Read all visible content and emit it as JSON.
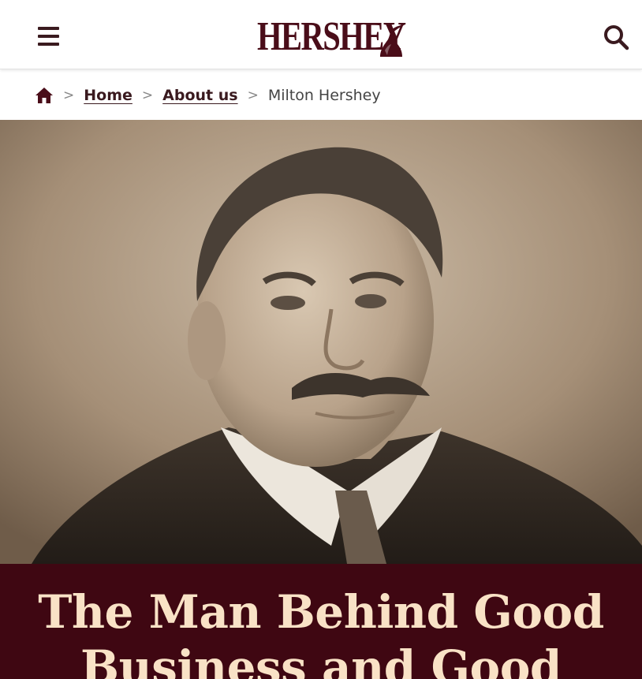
{
  "header": {
    "menu_icon": "hamburger-menu-icon",
    "logo_text": "HERSHEY",
    "logo_mark": "kiss-logo-icon",
    "search_icon": "search-icon",
    "brand_color": "#4a0d19"
  },
  "breadcrumb": {
    "home_icon": "home-icon",
    "separator": ">",
    "items": [
      {
        "label": "Home"
      },
      {
        "label": "About us"
      }
    ],
    "current": "Milton Hershey"
  },
  "hero": {
    "image_description": "sepia portrait photograph"
  },
  "title_band": {
    "title": "The Man Behind Good Business and Good",
    "background": "#3f0712",
    "text_color": "#f9e2c6"
  }
}
